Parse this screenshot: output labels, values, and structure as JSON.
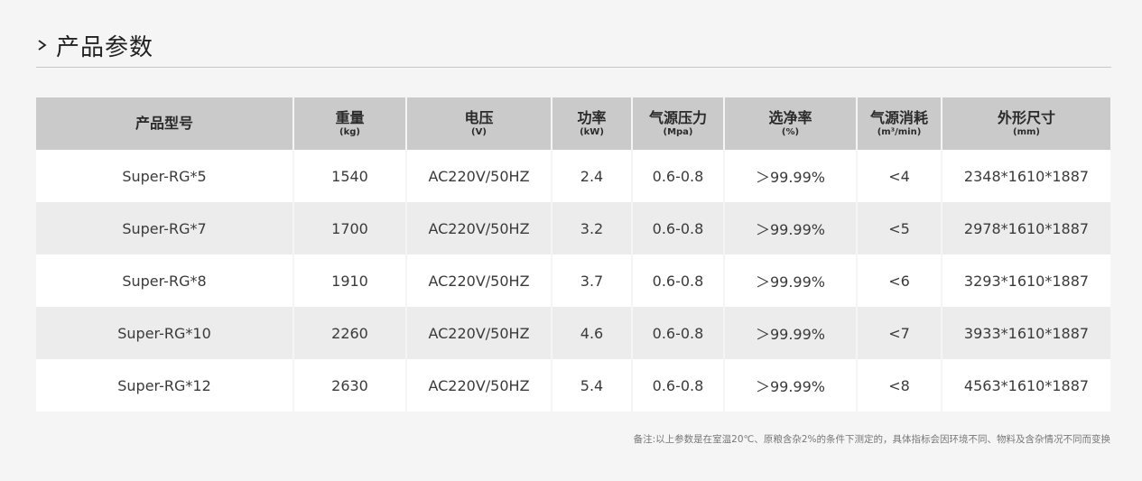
{
  "section": {
    "title": "产品参数",
    "chevron_icon": "chevron-right-icon"
  },
  "table": {
    "columns": [
      {
        "label": "产品型号",
        "unit": ""
      },
      {
        "label": "重量",
        "unit": "(kg)"
      },
      {
        "label": "电压",
        "unit": "(V)"
      },
      {
        "label": "功率",
        "unit": "(kW)"
      },
      {
        "label": "气源压力",
        "unit": "(Mpa)"
      },
      {
        "label": "选净率",
        "unit": "(%)"
      },
      {
        "label": "气源消耗",
        "unit": "(m³/min)"
      },
      {
        "label": "外形尺寸",
        "unit": "(mm)"
      }
    ],
    "rows": [
      [
        "Super-RG*5",
        "1540",
        "AC220V/50HZ",
        "2.4",
        "0.6-0.8",
        "＞99.99%",
        "<4",
        "2348*1610*1887"
      ],
      [
        "Super-RG*7",
        "1700",
        "AC220V/50HZ",
        "3.2",
        "0.6-0.8",
        "＞99.99%",
        "<5",
        "2978*1610*1887"
      ],
      [
        "Super-RG*8",
        "1910",
        "AC220V/50HZ",
        "3.7",
        "0.6-0.8",
        "＞99.99%",
        "<6",
        "3293*1610*1887"
      ],
      [
        "Super-RG*10",
        "2260",
        "AC220V/50HZ",
        "4.6",
        "0.6-0.8",
        "＞99.99%",
        "<7",
        "3933*1610*1887"
      ],
      [
        "Super-RG*12",
        "2630",
        "AC220V/50HZ",
        "5.4",
        "0.6-0.8",
        "＞99.99%",
        "<8",
        "4563*1610*1887"
      ]
    ]
  },
  "note": "备注:以上参数是在室温20℃、原粮含杂2%的条件下测定的，具体指标会因环境不同、物料及含杂情况不同而变换",
  "colors": {
    "background": "#f5f5f5",
    "header_bg": "#cacaca",
    "row_odd": "#ffffff",
    "row_even": "#ececec",
    "divider": "#c8c8c8"
  }
}
